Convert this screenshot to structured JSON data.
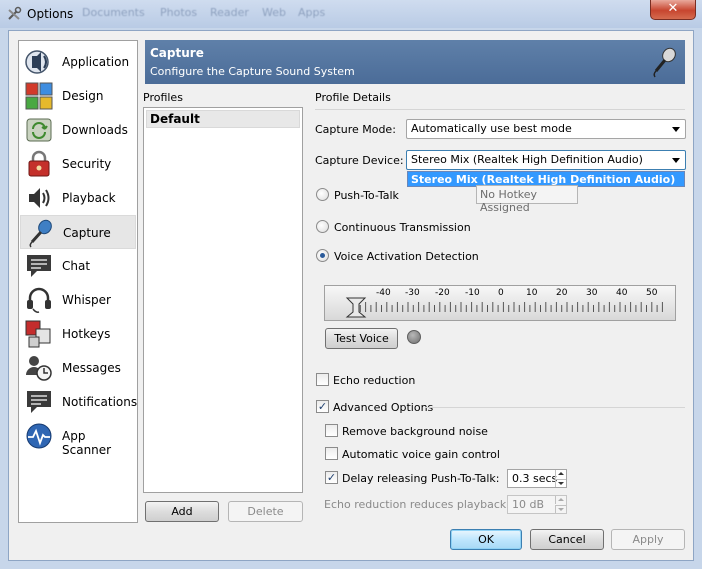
{
  "window": {
    "title": "Options",
    "background_tabs": [
      "Documents",
      "Photos",
      "Reader",
      "Web",
      "Apps"
    ],
    "close_symbol": "✕"
  },
  "nav": {
    "items": [
      {
        "label": "Application",
        "icon": "speaker-head-icon"
      },
      {
        "label": "Design",
        "icon": "color-squares-icon"
      },
      {
        "label": "Downloads",
        "icon": "downloads-icon"
      },
      {
        "label": "Security",
        "icon": "padlock-icon"
      },
      {
        "label": "Playback",
        "icon": "loudspeaker-icon"
      },
      {
        "label": "Capture",
        "icon": "microphone-icon",
        "selected": true
      },
      {
        "label": "Chat",
        "icon": "chat-bubble-icon"
      },
      {
        "label": "Whisper",
        "icon": "headset-icon"
      },
      {
        "label": "Hotkeys",
        "icon": "hotkeys-icon"
      },
      {
        "label": "Messages",
        "icon": "messages-icon"
      },
      {
        "label": "Notifications",
        "icon": "notifications-icon"
      },
      {
        "label": "App Scanner",
        "icon": "app-scanner-icon"
      }
    ]
  },
  "banner": {
    "title": "Capture",
    "subtitle": "Configure the Capture Sound System"
  },
  "profiles": {
    "heading": "Profiles",
    "items": [
      "Default"
    ],
    "add_label": "Add",
    "delete_label": "Delete"
  },
  "details": {
    "heading": "Profile Details",
    "capture_mode_label": "Capture Mode:",
    "capture_mode_value": "Automatically use best mode",
    "capture_device_label": "Capture Device:",
    "capture_device_value": "Stereo Mix (Realtek High Definition Audio)",
    "dropdown_option": "Stereo Mix (Realtek High Definition Audio)",
    "push_to_talk_label": "Push-To-Talk",
    "hotkey_value": "No Hotkey Assigned",
    "continuous_label": "Continuous Transmission",
    "vad_label": "Voice Activation Detection",
    "selected_mode": "vad",
    "meter_ticks": [
      "-40",
      "-30",
      "-20",
      "-10",
      "0",
      "10",
      "20",
      "30",
      "40",
      "50"
    ],
    "test_voice_label": "Test Voice",
    "echo_reduction_label": "Echo reduction",
    "echo_reduction_checked": false,
    "advanced_label": "Advanced Options",
    "advanced_checked": true,
    "remove_noise_label": "Remove background noise",
    "remove_noise_checked": false,
    "agc_label": "Automatic voice gain control",
    "agc_checked": false,
    "delay_ptt_label": "Delay releasing Push-To-Talk:",
    "delay_ptt_checked": true,
    "delay_ptt_value": "0.3 secs",
    "echo_playback_label": "Echo reduction reduces playback by:",
    "echo_playback_value": "10 dB"
  },
  "footer": {
    "ok_label": "OK",
    "cancel_label": "Cancel",
    "apply_label": "Apply"
  }
}
